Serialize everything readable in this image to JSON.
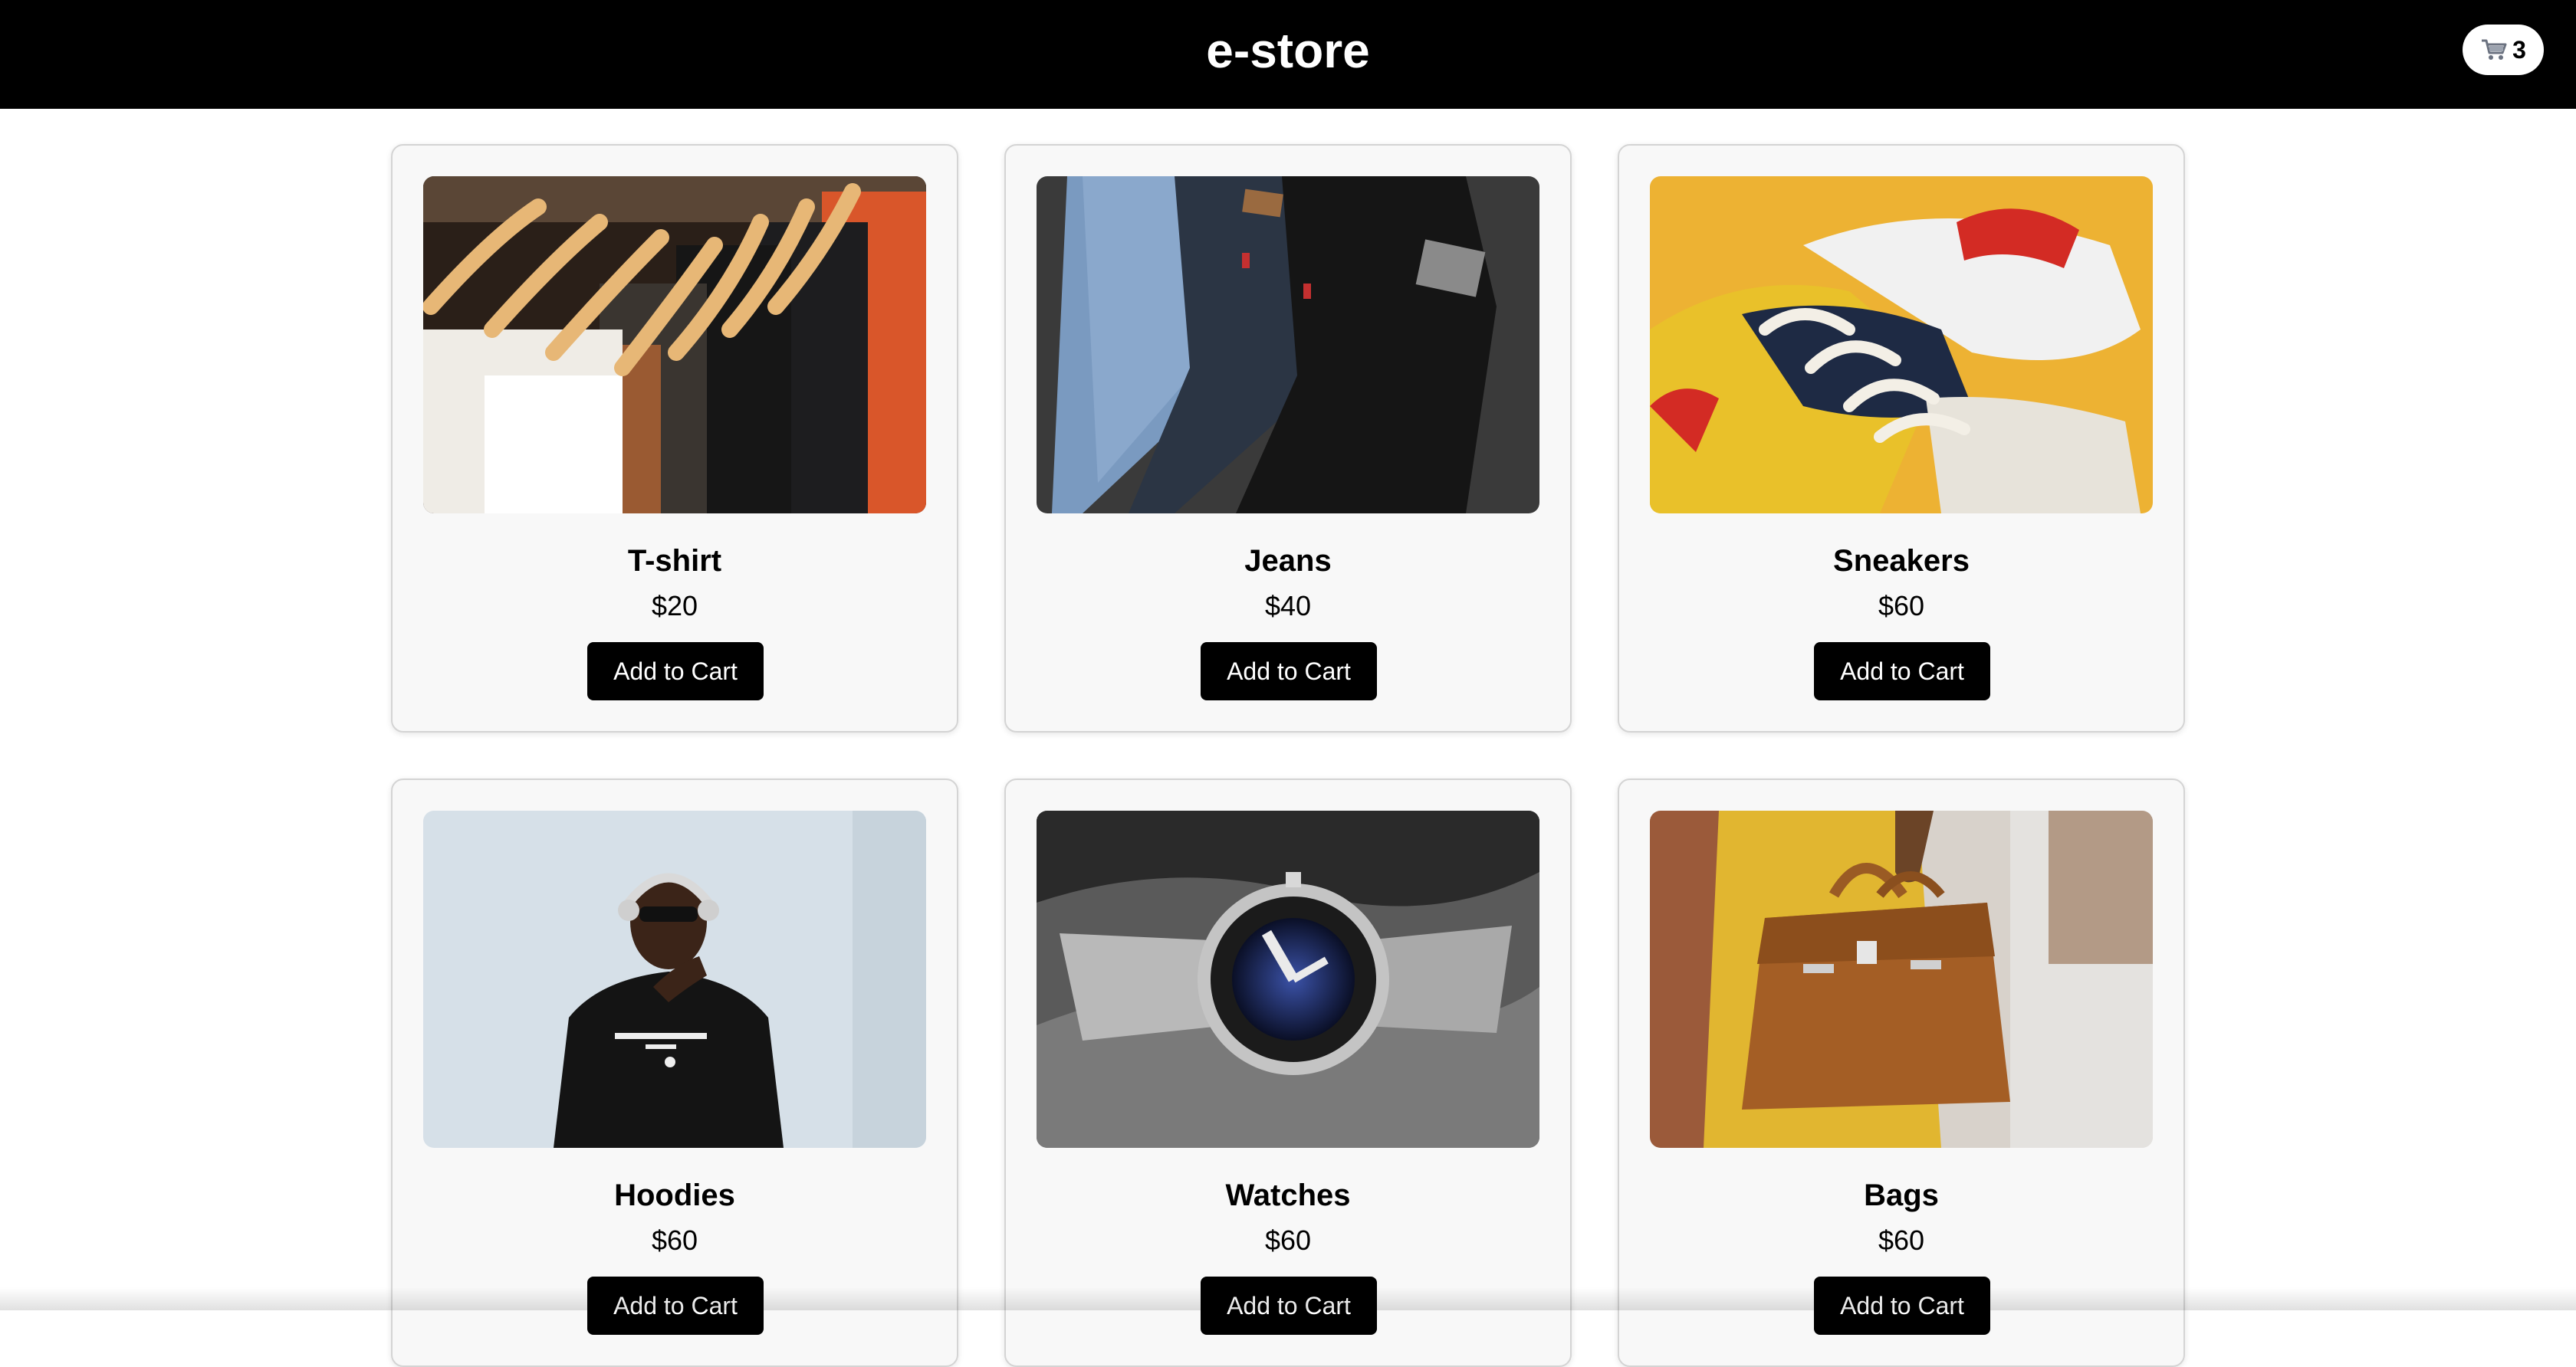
{
  "header": {
    "title": "e-store",
    "cart_icon": "cart-icon",
    "cart_count": "3"
  },
  "products": [
    {
      "name": "T-shirt",
      "price": "$20",
      "button_label": "Add to Cart",
      "image": "t-shirts-on-hangers"
    },
    {
      "name": "Jeans",
      "price": "$40",
      "button_label": "Add to Cart",
      "image": "folded-jeans"
    },
    {
      "name": "Sneakers",
      "price": "$60",
      "button_label": "Add to Cart",
      "image": "sneakers-on-yellow"
    },
    {
      "name": "Hoodies",
      "price": "$60",
      "button_label": "Add to Cart",
      "image": "man-in-black-hoodie"
    },
    {
      "name": "Watches",
      "price": "$60",
      "button_label": "Add to Cart",
      "image": "dive-watch"
    },
    {
      "name": "Bags",
      "price": "$60",
      "button_label": "Add to Cart",
      "image": "brown-suede-handbag"
    }
  ],
  "colors": {
    "header_bg": "#000000",
    "card_bg": "#f8f8f8",
    "button_bg": "#000000",
    "button_text": "#ffffff"
  }
}
